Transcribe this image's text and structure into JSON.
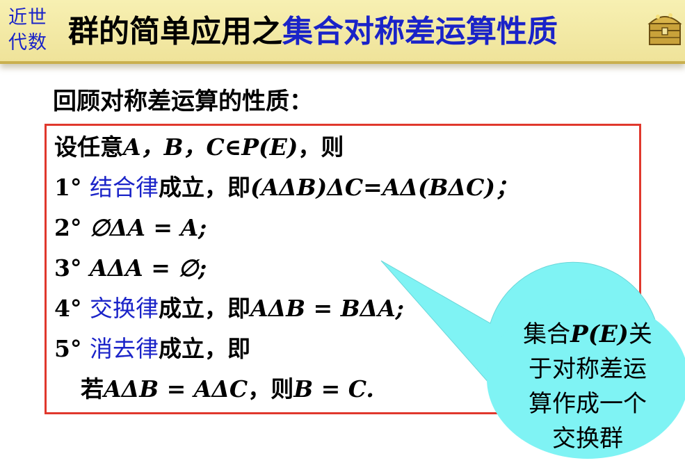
{
  "header": {
    "course_line1": "近世",
    "course_line2": "代数",
    "title_main": "群的简单应用之",
    "title_topic": "集合对称差运算性质",
    "colors": {
      "bar": "#f3ebaa",
      "accent_blue": "#1a23c8",
      "border_red": "#e0382d",
      "bubble": "#7ff3f4"
    }
  },
  "subheading": "回顾对称差运算的性质：",
  "box": {
    "intro": {
      "prefix": "设任意",
      "vars": "A，B，C",
      "elem": "∈",
      "set": "P(E)",
      "suffix": "，则"
    },
    "items": [
      {
        "num": "1°",
        "law": "结合律",
        "after": "成立，即",
        "formula": "(AΔB)ΔC=AΔ(BΔC)；"
      },
      {
        "num": "2°",
        "formula": "∅ΔA = A;"
      },
      {
        "num": "3°",
        "formula": "AΔA = ∅;"
      },
      {
        "num": "4°",
        "law": "交换律",
        "after": "成立，即",
        "formula": "AΔB = BΔA;"
      },
      {
        "num": "5°",
        "law": "消去律",
        "after": "成立，即"
      }
    ],
    "item5_cont": {
      "if": "若",
      "cond": "AΔB = AΔC",
      "then": "，则",
      "result": "B = C."
    }
  },
  "callout": {
    "line1_prefix": "集合",
    "line1_set": "P(E)",
    "line1_suffix": "关",
    "line2": "于对称差运",
    "line3": "算作成一个",
    "line4": "交换群"
  }
}
